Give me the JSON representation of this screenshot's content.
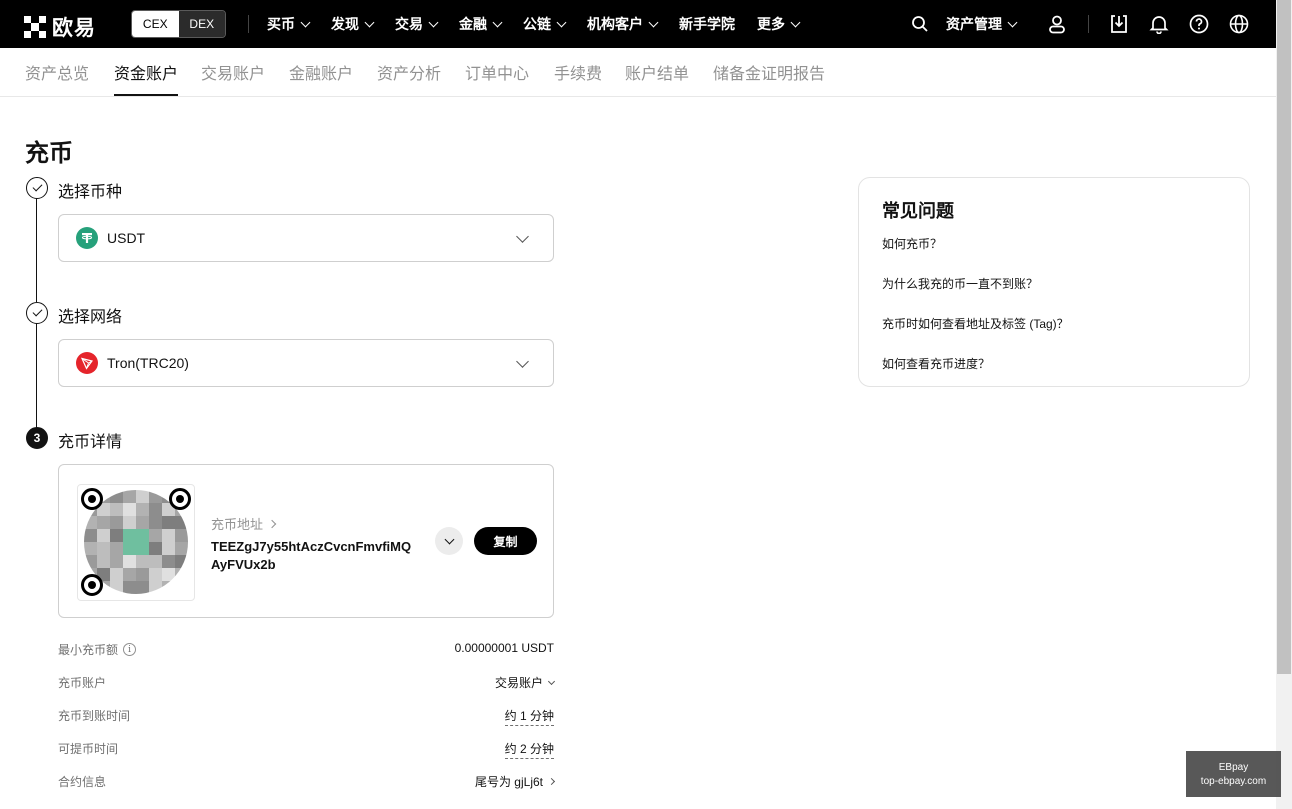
{
  "brand": {
    "logo_text": "欧易"
  },
  "mode_switch": {
    "options": [
      "CEX",
      "DEX"
    ],
    "selected": "CEX"
  },
  "nav": {
    "items": [
      {
        "label": "买币",
        "has_dropdown": true
      },
      {
        "label": "发现",
        "has_dropdown": true
      },
      {
        "label": "交易",
        "has_dropdown": true
      },
      {
        "label": "金融",
        "has_dropdown": true
      },
      {
        "label": "公链",
        "has_dropdown": true
      },
      {
        "label": "机构客户",
        "has_dropdown": true
      },
      {
        "label": "新手学院",
        "has_dropdown": false
      },
      {
        "label": "更多",
        "has_dropdown": true
      }
    ],
    "asset_management": "资产管理",
    "icons": [
      "search-icon",
      "user-icon",
      "download-icon",
      "bell-icon",
      "help-icon",
      "globe-icon"
    ]
  },
  "subtabs": {
    "items": [
      "资产总览",
      "资金账户",
      "交易账户",
      "金融账户",
      "资产分析",
      "订单中心",
      "手续费",
      "账户结单",
      "储备金证明报告"
    ],
    "active": "资金账户"
  },
  "page": {
    "title": "充币"
  },
  "steps": {
    "coin": {
      "label": "选择币种",
      "value": "USDT",
      "icon": "tether-icon",
      "icon_color": "#26A17B"
    },
    "network": {
      "label": "选择网络",
      "value": "Tron(TRC20)",
      "icon": "tron-icon",
      "icon_color": "#E5242B"
    },
    "detail": {
      "number": "3",
      "label": "充币详情"
    }
  },
  "deposit": {
    "address_label": "充币地址",
    "address": "TEEZgJ7y55htAczCvcnFmvfiMQAyFVUx2b",
    "copy_label": "复制"
  },
  "info": [
    {
      "key": "最小充币额",
      "value": "0.00000001 USDT",
      "has_info_icon": true
    },
    {
      "key": "充币账户",
      "value": "交易账户",
      "has_dropdown": true
    },
    {
      "key": "充币到账时间",
      "value": "约 1 分钟",
      "dashed": true
    },
    {
      "key": "可提币时间",
      "value": "约 2 分钟",
      "dashed": true
    },
    {
      "key": "合约信息",
      "value": "尾号为 gjLj6t",
      "has_arrow": true
    }
  ],
  "faq": {
    "title": "常见问题",
    "items": [
      "如何充币？",
      "为什么我充的币一直不到账？",
      "充币时如何查看地址及标签 (Tag)？",
      "如何查看充币进度？"
    ]
  },
  "watermark": {
    "line1": "EBpay",
    "line2": "top-ebpay.com"
  },
  "colors": {
    "accent": "#121212",
    "nav_bg": "#000000",
    "muted": "#929292"
  }
}
